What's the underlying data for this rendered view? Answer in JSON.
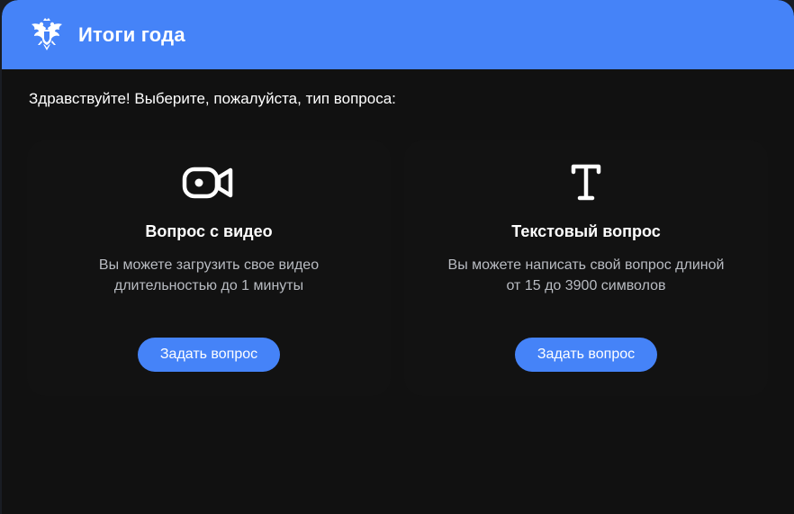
{
  "header": {
    "title": "Итоги года",
    "emblem_icon": "double-headed-eagle-emblem-icon"
  },
  "greeting": "Здравствуйте! Выберите, пожалуйста, тип вопроса:",
  "options": [
    {
      "icon": "video-camera-icon",
      "title": "Вопрос с видео",
      "description_line1": "Вы можете загрузить свое видео",
      "description_line2": "длительностью до 1 минуты",
      "button_label": "Задать вопрос"
    },
    {
      "icon": "text-t-icon",
      "title": "Текстовый вопрос",
      "description_line1": "Вы можете написать свой вопрос длиной",
      "description_line2": "от 15 до 3900 символов",
      "button_label": "Задать вопрос"
    }
  ],
  "colors": {
    "accent": "#4583f8",
    "background": "#111111",
    "text_primary": "#ffffff",
    "text_secondary": "#b9bcc2"
  }
}
